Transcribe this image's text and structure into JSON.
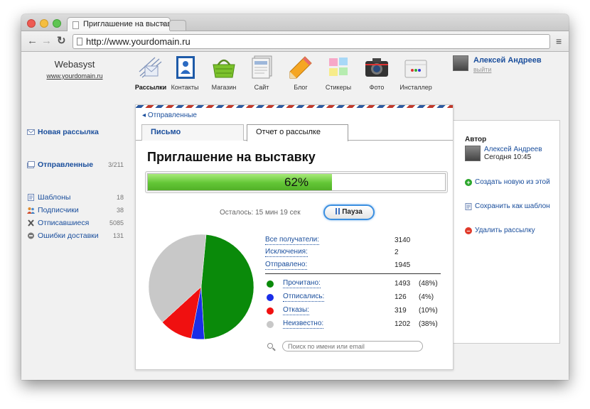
{
  "browser": {
    "tab_title": "Приглашение на выставку",
    "tab_close": "×",
    "url": "http://www.yourdomain.ru",
    "menu_glyph": "≡",
    "back_glyph": "←",
    "forward_glyph": "→",
    "reload_glyph": "↻"
  },
  "brand": {
    "name": "Webasyst",
    "link": "www.yourdomain.ru"
  },
  "apps": [
    {
      "label": "Рассылки",
      "icon": "mailer-icon",
      "active": true
    },
    {
      "label": "Контакты",
      "icon": "contacts-icon",
      "active": false
    },
    {
      "label": "Магазин",
      "icon": "shop-basket-icon",
      "active": false
    },
    {
      "label": "Сайт",
      "icon": "site-icon",
      "active": false
    },
    {
      "label": "Блог",
      "icon": "pencil-icon",
      "active": false
    },
    {
      "label": "Стикеры",
      "icon": "stickers-icon",
      "active": false
    },
    {
      "label": "Фото",
      "icon": "camera-icon",
      "active": false
    },
    {
      "label": "Инсталлер",
      "icon": "installer-icon",
      "active": false
    }
  ],
  "user": {
    "name": "Алексей Андреев",
    "logout": "выйти"
  },
  "sidebar": {
    "new_mailing": "Новая рассылка",
    "sent": {
      "label": "Отправленные",
      "count": "3/211"
    },
    "items": [
      {
        "label": "Шаблоны",
        "count": "18",
        "icon": "template-icon"
      },
      {
        "label": "Подписчики",
        "count": "38",
        "icon": "subscribers-icon"
      },
      {
        "label": "Отписавшиеся",
        "count": "5085",
        "icon": "unsubscribed-icon"
      },
      {
        "label": "Ошибки доставки",
        "count": "131",
        "icon": "delivery-error-icon"
      }
    ]
  },
  "main": {
    "back_link": "Отправленные",
    "back_glyph": "◂",
    "tabs": [
      {
        "label": "Письмо",
        "active": false
      },
      {
        "label": "Отчет о рассылке",
        "active": true
      }
    ],
    "title": "Приглашение на выставку",
    "progress": {
      "value": 0.62,
      "label": "62%"
    },
    "remaining": "Осталось: 15 мин 19 сек",
    "pause_label": "Пауза",
    "totals": [
      {
        "label": "Все получатели:",
        "value": "3140"
      },
      {
        "label": "Исключения:",
        "value": "2"
      },
      {
        "label": "Отправлено:",
        "value": "1945"
      }
    ],
    "statuses": [
      {
        "label": "Прочитано:",
        "value": "1493",
        "pct": "(48%)",
        "color": "#0a8a0a"
      },
      {
        "label": "Отписались:",
        "value": "126",
        "pct": "(4%)",
        "color": "#1a2ee8"
      },
      {
        "label": "Отказы:",
        "value": "319",
        "pct": "(10%)",
        "color": "#f01010"
      },
      {
        "label": "Неизвестно:",
        "value": "1202",
        "pct": "(38%)",
        "color": "#c8c8c8"
      }
    ],
    "search_placeholder": "Поиск по имени или email"
  },
  "right": {
    "author_heading": "Автор",
    "author_name": "Алексей Андреев",
    "author_date": "Сегодня 10:45",
    "actions": [
      {
        "label": "Создать новую из этой",
        "icon": "plus-circle-icon",
        "color": "#2aa52a"
      },
      {
        "label": "Сохранить как шаблон",
        "icon": "template-icon",
        "color": ""
      },
      {
        "label": "Удалить рассылку",
        "icon": "delete-circle-icon",
        "color": "#e03a2a"
      }
    ]
  }
}
